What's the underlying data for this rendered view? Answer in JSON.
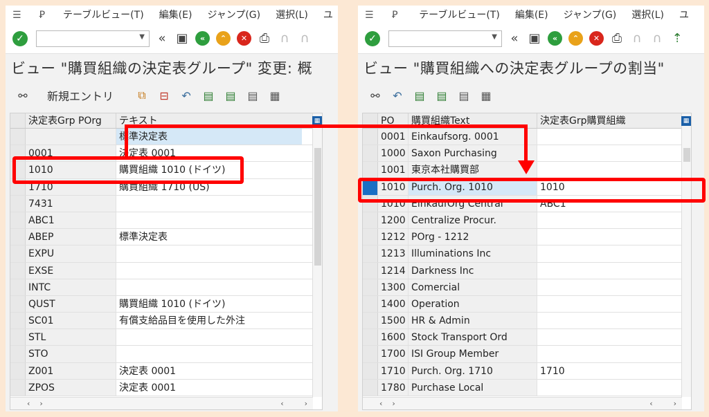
{
  "left": {
    "menu": [
      "テーブルビュー(T)",
      "編集(E)",
      "ジャンプ(G)",
      "選択(L)",
      "ユ"
    ],
    "title": "ビュー \"購買組織の決定表グループ\" 変更: 概",
    "app_toolbar_label": "新規エントリ",
    "columns": [
      "決定表Grp POrg",
      "テキスト"
    ],
    "header_row_text": "標準決定表",
    "rows": [
      {
        "key": "0001",
        "text": "決定表 0001"
      },
      {
        "key": "1010",
        "text": "購買組織 1010 (ドイツ)"
      },
      {
        "key": "1710",
        "text": "購買組織 1710 (US)"
      },
      {
        "key": "7431",
        "text": ""
      },
      {
        "key": "ABC1",
        "text": ""
      },
      {
        "key": "ABEP",
        "text": "標準決定表"
      },
      {
        "key": "EXPU",
        "text": ""
      },
      {
        "key": "EXSE",
        "text": ""
      },
      {
        "key": "INTC",
        "text": ""
      },
      {
        "key": "QUST",
        "text": "購買組織 1010 (ドイツ)"
      },
      {
        "key": "SC01",
        "text": "有償支給品目を使用した外注"
      },
      {
        "key": "STL",
        "text": ""
      },
      {
        "key": "STO",
        "text": ""
      },
      {
        "key": "Z001",
        "text": "決定表 0001"
      },
      {
        "key": "ZPOS",
        "text": "決定表 0001"
      }
    ]
  },
  "right": {
    "menu": [
      "テーブルビュー(T)",
      "編集(E)",
      "ジャンプ(G)",
      "選択(L)",
      "ユ"
    ],
    "title": "ビュー \"購買組織への決定表グループの割当\"",
    "columns": [
      "PO",
      "購買組織Text",
      "決定表Grp購買組織"
    ],
    "rows": [
      {
        "po": "0001",
        "text": "Einkaufsorg. 0001",
        "grp": ""
      },
      {
        "po": "1000",
        "text": "Saxon Purchasing",
        "grp": ""
      },
      {
        "po": "1001",
        "text": "東京本社購買部",
        "grp": ""
      },
      {
        "po": "1010",
        "text": "Purch. Org. 1010",
        "grp": "1010"
      },
      {
        "po": "1010",
        "text": "EinkaufOrg Central",
        "grp": "ABC1"
      },
      {
        "po": "1200",
        "text": "Centralize Procur.",
        "grp": ""
      },
      {
        "po": "1212",
        "text": "POrg - 1212",
        "grp": ""
      },
      {
        "po": "1213",
        "text": "Illuminations Inc",
        "grp": ""
      },
      {
        "po": "1214",
        "text": "Darkness Inc",
        "grp": ""
      },
      {
        "po": "1300",
        "text": "Comercial",
        "grp": ""
      },
      {
        "po": "1400",
        "text": "Operation",
        "grp": ""
      },
      {
        "po": "1500",
        "text": "HR & Admin",
        "grp": ""
      },
      {
        "po": "1600",
        "text": "Stock Transport Ord",
        "grp": ""
      },
      {
        "po": "1700",
        "text": "ISI Group Member",
        "grp": ""
      },
      {
        "po": "1710",
        "text": "Purch. Org. 1710",
        "grp": "1710"
      },
      {
        "po": "1780",
        "text": "Purchase Local",
        "grp": ""
      }
    ]
  },
  "colors": {
    "highlight": "#ff0000",
    "ok": "#2e9e3e",
    "background": "#fce8d4"
  }
}
